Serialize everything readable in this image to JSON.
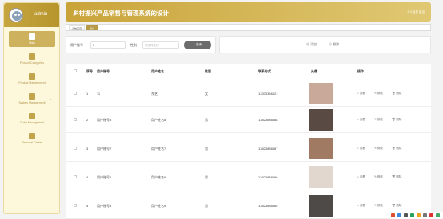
{
  "sidebar": {
    "username": "admin",
    "items": [
      {
        "label": "Main",
        "icon": "home-icon"
      },
      {
        "label": "Product Categories",
        "icon": "category-icon"
      },
      {
        "label": "Product Management",
        "icon": "product-icon"
      },
      {
        "label": "System Management",
        "icon": "grid-icon"
      },
      {
        "label": "Order Management",
        "icon": "order-icon"
      },
      {
        "label": "Personal Center",
        "icon": "user-icon"
      }
    ]
  },
  "header": {
    "title": "乡村振兴产品销售与管理系统的设计",
    "right_text": "个人信息 退出"
  },
  "breadcrumbs": [
    "系统首页",
    "用户"
  ],
  "search": {
    "account_label": "用户账号",
    "account_value": "1",
    "gender_label": "性别",
    "gender_placeholder": "请选择性别",
    "search_button": "查询",
    "add_button": "添加",
    "delete_button": "删除"
  },
  "table": {
    "headers": [
      "序号",
      "用户账号",
      "用户姓名",
      "性别",
      "联系方式",
      "头像",
      "操作"
    ],
    "rows": [
      {
        "index": "1",
        "account": "11",
        "name": "东艺",
        "gender": "女",
        "phone": "13333366521"
      },
      {
        "index": "2",
        "account": "用户账号8",
        "name": "用户姓名8",
        "gender": "男",
        "phone": "13823888888"
      },
      {
        "index": "3",
        "account": "用户账号7",
        "name": "用户姓名7",
        "gender": "男",
        "phone": "13823888887"
      },
      {
        "index": "4",
        "account": "用户账号6",
        "name": "用户姓名6",
        "gender": "男",
        "phone": "13823888886"
      },
      {
        "index": "5",
        "account": "用户账号5",
        "name": "用户姓名5",
        "gender": "男",
        "phone": "13823888885"
      }
    ],
    "actions": {
      "view": "查看",
      "edit": "修改",
      "delete": "删除"
    }
  },
  "colors": {
    "accent": "#c6a43f",
    "sidebar_bg": "#fdf7dc"
  }
}
